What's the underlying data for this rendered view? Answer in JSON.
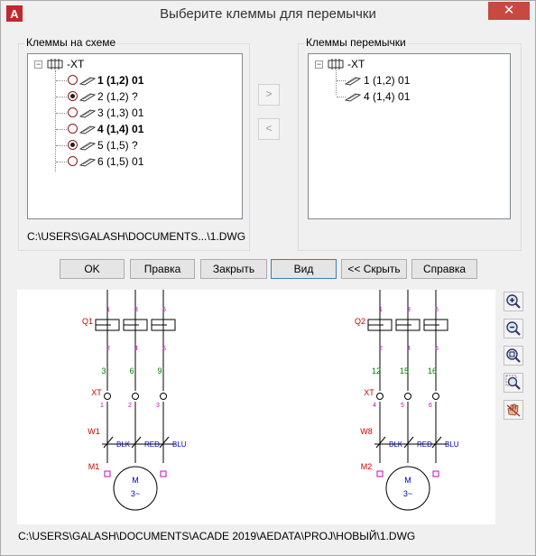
{
  "window": {
    "title": "Выберите клеммы для перемычки",
    "close_glyph": "✕"
  },
  "left_panel": {
    "label": "Клеммы на схеме",
    "root": "-XT",
    "items": [
      {
        "label": "1 (1,2) 01",
        "bold": true,
        "radio": false
      },
      {
        "label": "2 (1,2) ?",
        "bold": false,
        "radio": true
      },
      {
        "label": "3 (1,3) 01",
        "bold": false,
        "radio": false
      },
      {
        "label": "4 (1,4) 01",
        "bold": true,
        "radio": false
      },
      {
        "label": "5 (1,5) ?",
        "bold": false,
        "radio": true
      },
      {
        "label": "6 (1,5) 01",
        "bold": false,
        "radio": false
      }
    ],
    "path": "C:\\USERS\\GALASH\\DOCUMENTS...\\1.DWG"
  },
  "right_panel": {
    "label": "Клеммы перемычки",
    "root": "-XT",
    "items": [
      {
        "label": "1 (1,2) 01"
      },
      {
        "label": "4 (1,4) 01"
      }
    ]
  },
  "transfer": {
    "add": ">",
    "remove": "<"
  },
  "buttons": {
    "ok": "OK",
    "edit": "Правка",
    "close": "Закрыть",
    "view": "Вид",
    "hide": "<< Скрыть",
    "help": "Справка"
  },
  "preview": {
    "left": {
      "breaker": "Q1",
      "breaker_pins_top": [
        "1",
        "3",
        "5"
      ],
      "breaker_pins_bottom": [
        "2",
        "4",
        "6"
      ],
      "wires": [
        "3",
        "6",
        "9"
      ],
      "terminal_label": "XT",
      "terminal_nums": [
        "1",
        "2",
        "3"
      ],
      "cable": "W1",
      "colors": [
        "BLK",
        "RED",
        "BLU"
      ],
      "motor": "M1",
      "motor_label_top": "M",
      "motor_label_bottom": "3~"
    },
    "right": {
      "breaker": "Q2",
      "breaker_pins_top": [
        "1",
        "3",
        "5"
      ],
      "breaker_pins_bottom": [
        "2",
        "4",
        "6"
      ],
      "wires": [
        "12",
        "15",
        "16"
      ],
      "terminal_label": "XT",
      "terminal_nums": [
        "4",
        "5",
        "6"
      ],
      "cable": "W8",
      "colors": [
        "BLK",
        "RED",
        "BLU"
      ],
      "motor": "M2",
      "motor_label_top": "M",
      "motor_label_bottom": "3~"
    }
  },
  "tools": [
    "zoom-in-icon",
    "zoom-out-icon",
    "zoom-window-icon",
    "zoom-extents-icon",
    "pan-icon"
  ],
  "footer_path": "C:\\USERS\\GALASH\\DOCUMENTS\\ACADE 2019\\AEDATA\\PROJ\\НОВЫЙ\\1.DWG",
  "colors": {
    "device_red": "#cc0000",
    "wire_green": "#008000",
    "pin_magenta": "#cc00cc",
    "cable_blue": "#0000cc"
  }
}
